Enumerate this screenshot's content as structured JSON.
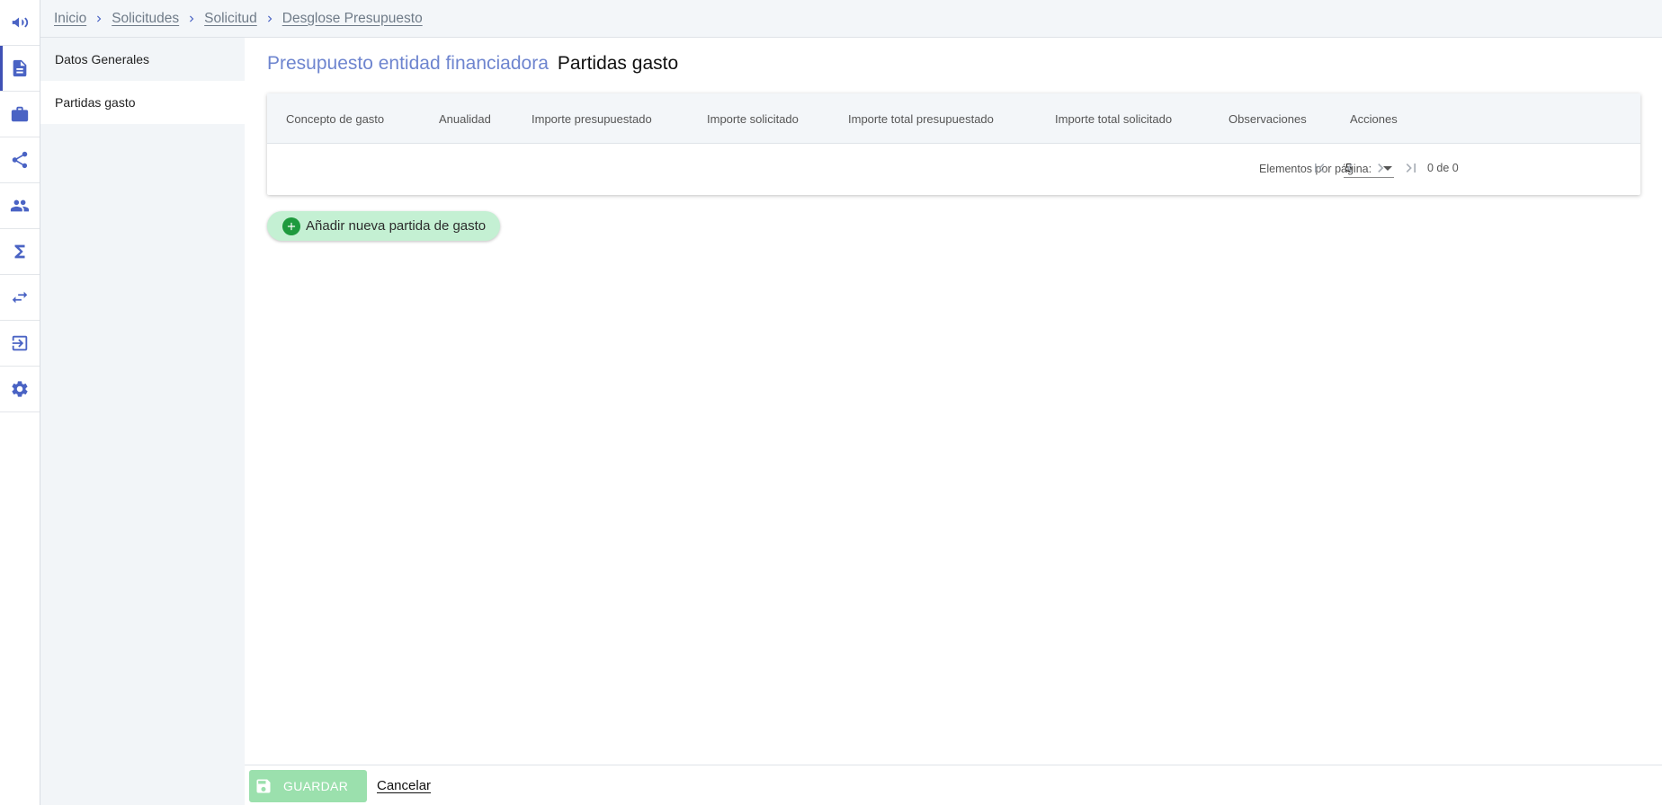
{
  "breadcrumb": {
    "items": [
      "Inicio",
      "Solicitudes",
      "Solicitud",
      "Desglose Presupuesto"
    ]
  },
  "rail": {
    "icons": [
      "megaphone-icon",
      "document-icon",
      "briefcase-icon",
      "share-icon",
      "people-icon",
      "sigma-icon",
      "swap-icon",
      "exit-icon",
      "gear-icon"
    ],
    "active_index": 1
  },
  "subnav": {
    "items": [
      {
        "label": "Datos Generales",
        "active": false
      },
      {
        "label": "Partidas gasto",
        "active": true
      }
    ]
  },
  "main": {
    "heading_sub": "Presupuesto entidad financiadora",
    "heading_main": "Partidas gasto",
    "table": {
      "columns": [
        "Concepto de gasto",
        "Anualidad",
        "Importe presupuestado",
        "Importe solicitado",
        "Importe total presupuestado",
        "Importe total solicitado",
        "Observaciones",
        "Acciones"
      ],
      "rows": []
    },
    "paginator": {
      "items_per_page_label": "Elementos por página:",
      "page_size": "5",
      "range_label": "0 de 0"
    },
    "add_button_label": "Añadir nueva partida de gasto"
  },
  "footer": {
    "save_label": "GUARDAR",
    "cancel_label": "Cancelar"
  },
  "colors": {
    "accent": "#4a63c4",
    "heading_sub": "#6e85cf",
    "add_button_bg": "#c4f0d3",
    "add_icon": "#1e9a3e",
    "save_button_bg": "#9be0ad"
  }
}
